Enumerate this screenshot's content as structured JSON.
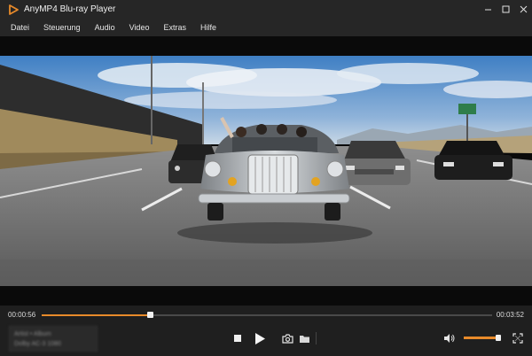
{
  "window": {
    "title": "AnyMP4 Blu-ray Player",
    "logo_icon": "play-triangle-logo-icon",
    "accent_color": "#e88a2a"
  },
  "menu": {
    "items": [
      "Datei",
      "Steuerung",
      "Audio",
      "Video",
      "Extras",
      "Hilfe"
    ]
  },
  "playback": {
    "current_time": "00:00:56",
    "total_time": "00:03:52",
    "progress": 0.24,
    "volume": 0.98,
    "info_lines": [
      "Artist • Album",
      "Dolby AC-3 1080"
    ]
  },
  "video": {
    "content": "convertible-car-highway-scene"
  }
}
